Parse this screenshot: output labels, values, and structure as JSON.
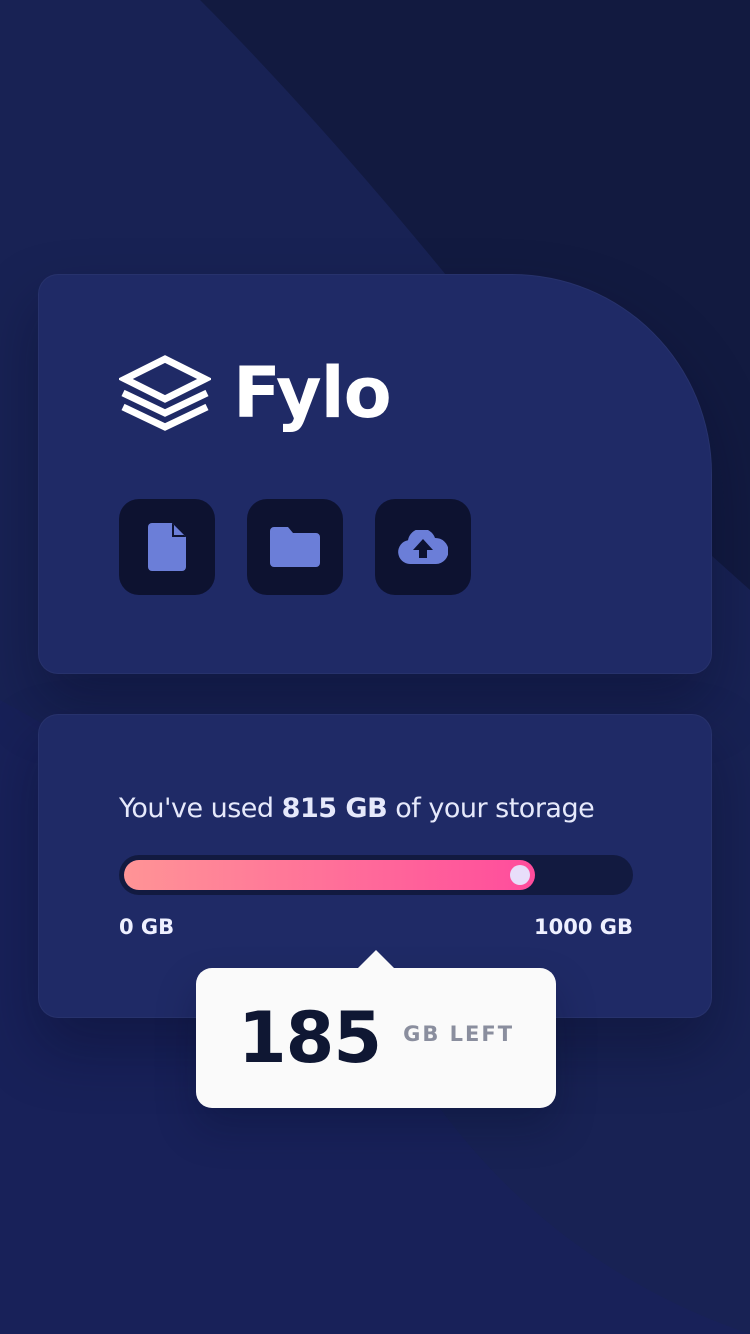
{
  "colors": {
    "background": "#121a40",
    "card": "#1f2a66",
    "icon_tile": "#0d1230",
    "icon_fill": "#6b7ed8",
    "bar_start": "#ff9496",
    "bar_end": "#ff4c9c",
    "tooltip_bg": "#fafafa"
  },
  "brand": {
    "name": "Fylo",
    "logo_icon": "stacked-layers-icon"
  },
  "actions": [
    {
      "icon": "document-icon"
    },
    {
      "icon": "folder-icon"
    },
    {
      "icon": "cloud-upload-icon"
    }
  ],
  "usage": {
    "prefix": "You've used ",
    "amount": "815 GB",
    "suffix": " of your storage",
    "used_fraction": 0.815,
    "min_label": "0 GB",
    "max_label": "1000 GB"
  },
  "remaining": {
    "value": "185",
    "unit": "GB LEFT"
  }
}
